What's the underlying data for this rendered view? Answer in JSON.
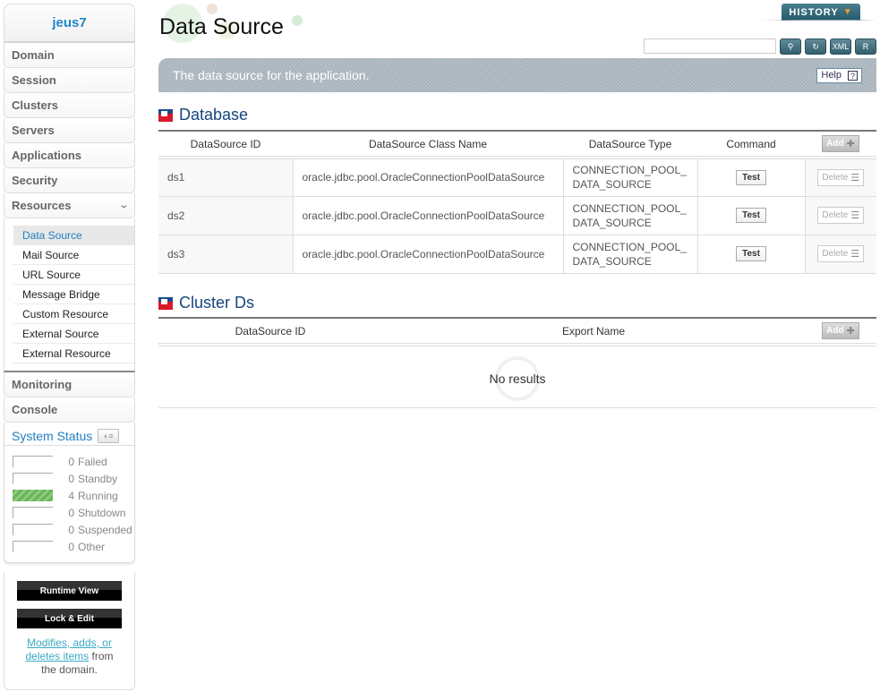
{
  "sidebar": {
    "domain_name": "jeus7",
    "menu": [
      {
        "label": "Domain"
      },
      {
        "label": "Session"
      },
      {
        "label": "Clusters"
      },
      {
        "label": "Servers"
      },
      {
        "label": "Applications"
      },
      {
        "label": "Security"
      },
      {
        "label": "Resources",
        "expanded": true
      }
    ],
    "resources_submenu": [
      {
        "label": "Data Source",
        "active": true
      },
      {
        "label": "Mail Source"
      },
      {
        "label": "URL Source"
      },
      {
        "label": "Message Bridge"
      },
      {
        "label": "Custom Resource"
      },
      {
        "label": "External Source"
      },
      {
        "label": "External Resource"
      }
    ],
    "menu_after": [
      {
        "label": "Monitoring"
      },
      {
        "label": "Console"
      }
    ],
    "system_status": {
      "title": "System Status",
      "rows": [
        {
          "count": "0",
          "label": "Failed"
        },
        {
          "count": "0",
          "label": "Standby"
        },
        {
          "count": "4",
          "label": "Running"
        },
        {
          "count": "0",
          "label": "Shutdown"
        },
        {
          "count": "0",
          "label": "Suspended"
        },
        {
          "count": "0",
          "label": "Other"
        }
      ]
    },
    "runtime_view_label": "Runtime View",
    "lock_edit_label": "Lock & Edit",
    "hint_link": "Modifies, adds, or deletes items",
    "hint_rest": " from the domain."
  },
  "header": {
    "page_title": "Data Source",
    "history_label": "HISTORY",
    "search_value": "",
    "tools": [
      {
        "icon": "search-icon",
        "glyph": "🔍"
      },
      {
        "icon": "refresh-icon",
        "glyph": "↻"
      },
      {
        "icon": "xml-export-icon",
        "glyph": "XML"
      },
      {
        "icon": "apply-icon",
        "glyph": "R"
      }
    ]
  },
  "banner": {
    "text": "The data source for the application.",
    "help_label": "Help",
    "help_glyph": "?"
  },
  "database": {
    "title": "Database",
    "columns": [
      "DataSource ID",
      "DataSource Class Name",
      "DataSource Type",
      "Command"
    ],
    "add_label": "Add",
    "test_label": "Test",
    "delete_label": "Delete",
    "rows": [
      {
        "id": "ds1",
        "class_name": "oracle.jdbc.pool.OracleConnectionPoolDataSource",
        "type_line1": "CONNECTION_POOL_",
        "type_line2": "DATA_SOURCE"
      },
      {
        "id": "ds2",
        "class_name": "oracle.jdbc.pool.OracleConnectionPoolDataSource",
        "type_line1": "CONNECTION_POOL_",
        "type_line2": "DATA_SOURCE"
      },
      {
        "id": "ds3",
        "class_name": "oracle.jdbc.pool.OracleConnectionPoolDataSource",
        "type_line1": "CONNECTION_POOL_",
        "type_line2": "DATA_SOURCE"
      }
    ]
  },
  "cluster_ds": {
    "title": "Cluster Ds",
    "columns": [
      "DataSource ID",
      "Export Name"
    ],
    "add_label": "Add",
    "empty_text": "No results"
  }
}
